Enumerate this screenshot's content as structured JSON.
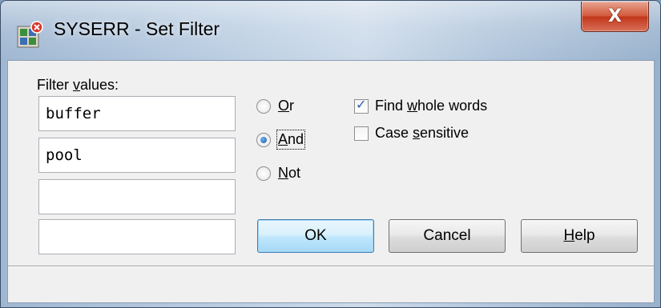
{
  "window": {
    "title": "SYSERR - Set Filter",
    "close_glyph": "X"
  },
  "icons": {
    "app": "app-icon",
    "close": "close-icon"
  },
  "filter": {
    "label_pre": "Filter ",
    "label_accel": "v",
    "label_post": "alues:",
    "values": [
      "buffer",
      "pool",
      "",
      ""
    ]
  },
  "operators": [
    {
      "accel": "O",
      "rest": "r",
      "checked": false
    },
    {
      "accel": "A",
      "rest": "nd",
      "checked": true
    },
    {
      "accel": "N",
      "rest": "ot",
      "checked": false
    }
  ],
  "options": {
    "whole_words": {
      "pre": "Find ",
      "accel": "w",
      "post": "hole words",
      "checked": true
    },
    "case_sensitive": {
      "pre": "Case ",
      "accel": "s",
      "post": "ensitive",
      "checked": false
    }
  },
  "buttons": {
    "ok": "OK",
    "cancel": "Cancel",
    "help_accel": "H",
    "help_rest": "elp"
  },
  "colors": {
    "accent": "#3c7fb1",
    "close": "#c2371a"
  }
}
